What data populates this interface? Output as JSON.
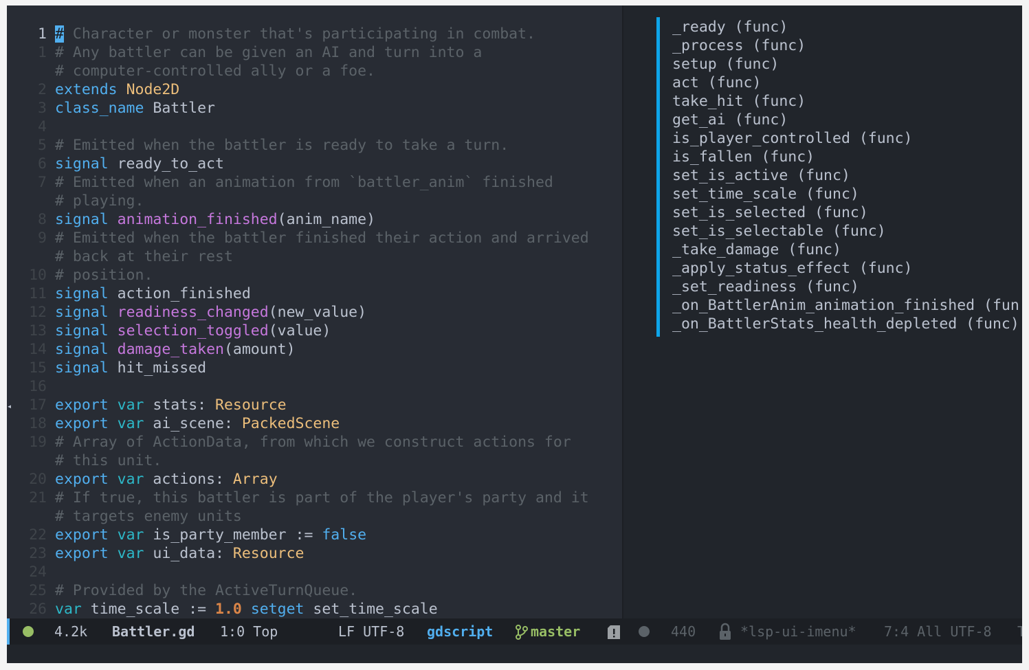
{
  "editor": {
    "lines": [
      {
        "n": "1",
        "cur": true,
        "t": [
          [
            "cursor",
            "#"
          ],
          [
            "comment",
            " Character or monster that's participating in combat."
          ]
        ]
      },
      {
        "n": "1",
        "t": [
          [
            "comment",
            "# Any battler can be given an AI and turn into a"
          ]
        ]
      },
      {
        "n": "",
        "t": [
          [
            "comment",
            "# computer-controlled ally or a foe."
          ]
        ]
      },
      {
        "n": "2",
        "t": [
          [
            "kw",
            "extends"
          ],
          [
            "plain",
            " "
          ],
          [
            "type",
            "Node2D"
          ]
        ]
      },
      {
        "n": "3",
        "t": [
          [
            "kw",
            "class_name"
          ],
          [
            "plain",
            " Battler"
          ]
        ]
      },
      {
        "n": "4",
        "t": []
      },
      {
        "n": "5",
        "t": [
          [
            "comment",
            "# Emitted when the battler is ready to take a turn."
          ]
        ]
      },
      {
        "n": "6",
        "t": [
          [
            "kw",
            "signal"
          ],
          [
            "plain",
            " ready_to_act"
          ]
        ]
      },
      {
        "n": "7",
        "t": [
          [
            "comment",
            "# Emitted when an animation from `battler_anim` finished"
          ]
        ]
      },
      {
        "n": "",
        "t": [
          [
            "comment",
            "# playing."
          ]
        ]
      },
      {
        "n": "8",
        "t": [
          [
            "kw",
            "signal"
          ],
          [
            "plain",
            " "
          ],
          [
            "fn",
            "animation_finished"
          ],
          [
            "plain",
            "(anim_name)"
          ]
        ]
      },
      {
        "n": "9",
        "t": [
          [
            "comment",
            "# Emitted when the battler finished their action and arrived"
          ]
        ]
      },
      {
        "n": "",
        "t": [
          [
            "comment",
            "# back at their rest"
          ]
        ]
      },
      {
        "n": "10",
        "t": [
          [
            "comment",
            "# position."
          ]
        ]
      },
      {
        "n": "11",
        "t": [
          [
            "kw",
            "signal"
          ],
          [
            "plain",
            " action_finished"
          ]
        ]
      },
      {
        "n": "12",
        "t": [
          [
            "kw",
            "signal"
          ],
          [
            "plain",
            " "
          ],
          [
            "fn",
            "readiness_changed"
          ],
          [
            "plain",
            "(new_value)"
          ]
        ]
      },
      {
        "n": "13",
        "t": [
          [
            "kw",
            "signal"
          ],
          [
            "plain",
            " "
          ],
          [
            "fn",
            "selection_toggled"
          ],
          [
            "plain",
            "(value)"
          ]
        ]
      },
      {
        "n": "14",
        "t": [
          [
            "kw",
            "signal"
          ],
          [
            "plain",
            " "
          ],
          [
            "fn",
            "damage_taken"
          ],
          [
            "plain",
            "(amount)"
          ]
        ]
      },
      {
        "n": "15",
        "t": [
          [
            "kw",
            "signal"
          ],
          [
            "plain",
            " hit_missed"
          ]
        ]
      },
      {
        "n": "16",
        "t": []
      },
      {
        "n": "17",
        "t": [
          [
            "kw",
            "export"
          ],
          [
            "plain",
            " "
          ],
          [
            "var",
            "var"
          ],
          [
            "plain",
            " stats: "
          ],
          [
            "type",
            "Resource"
          ]
        ]
      },
      {
        "n": "18",
        "t": [
          [
            "kw",
            "export"
          ],
          [
            "plain",
            " "
          ],
          [
            "var",
            "var"
          ],
          [
            "plain",
            " ai_scene: "
          ],
          [
            "type",
            "PackedScene"
          ]
        ]
      },
      {
        "n": "19",
        "t": [
          [
            "comment",
            "# Array of ActionData, from which we construct actions for"
          ]
        ]
      },
      {
        "n": "",
        "t": [
          [
            "comment",
            "# this unit."
          ]
        ]
      },
      {
        "n": "20",
        "t": [
          [
            "kw",
            "export"
          ],
          [
            "plain",
            " "
          ],
          [
            "var",
            "var"
          ],
          [
            "plain",
            " actions: "
          ],
          [
            "type",
            "Array"
          ]
        ]
      },
      {
        "n": "21",
        "t": [
          [
            "comment",
            "# If true, this battler is part of the player's party and it"
          ]
        ]
      },
      {
        "n": "",
        "t": [
          [
            "comment",
            "# targets enemy units"
          ]
        ]
      },
      {
        "n": "22",
        "t": [
          [
            "kw",
            "export"
          ],
          [
            "plain",
            " "
          ],
          [
            "var",
            "var"
          ],
          [
            "plain",
            " is_party_member := "
          ],
          [
            "const",
            "false"
          ]
        ]
      },
      {
        "n": "23",
        "t": [
          [
            "kw",
            "export"
          ],
          [
            "plain",
            " "
          ],
          [
            "var",
            "var"
          ],
          [
            "plain",
            " ui_data: "
          ],
          [
            "type",
            "Resource"
          ]
        ]
      },
      {
        "n": "24",
        "t": []
      },
      {
        "n": "25",
        "t": [
          [
            "comment",
            "# Provided by the ActiveTurnQueue."
          ]
        ]
      },
      {
        "n": "26",
        "t": [
          [
            "var",
            "var"
          ],
          [
            "plain",
            " time_scale := "
          ],
          [
            "num",
            "1.0"
          ],
          [
            "plain",
            " "
          ],
          [
            "kw",
            "setget"
          ],
          [
            "plain",
            " set_time_scale"
          ]
        ]
      }
    ]
  },
  "imenu": {
    "items": [
      "_ready (func)",
      "_process (func)",
      "setup (func)",
      "act (func)",
      "take_hit (func)",
      "get_ai (func)",
      "is_player_controlled (func)",
      "is_fallen (func)",
      "set_is_active (func)",
      "set_time_scale (func)",
      "set_is_selected (func)",
      "set_is_selectable (func)",
      "_take_damage (func)",
      "_apply_status_effect (func)",
      "_set_readiness (func)",
      "_on_BattlerAnim_animation_finished (fun",
      "_on_BattlerStats_health_depleted (func)"
    ]
  },
  "modeline": {
    "size": "4.2k",
    "filename": "Battler.gd",
    "position": "1:0 Top",
    "encoding": "LF UTF-8",
    "mode": "gdscript",
    "branch": "master",
    "count": "440",
    "other_buffer": "*lsp-ui-imenu*",
    "other_position": "7:4 All UTF-8",
    "cut": "T"
  },
  "colors": {
    "accent": "#51afef",
    "ok": "#98be65",
    "bg": "#282c34"
  }
}
